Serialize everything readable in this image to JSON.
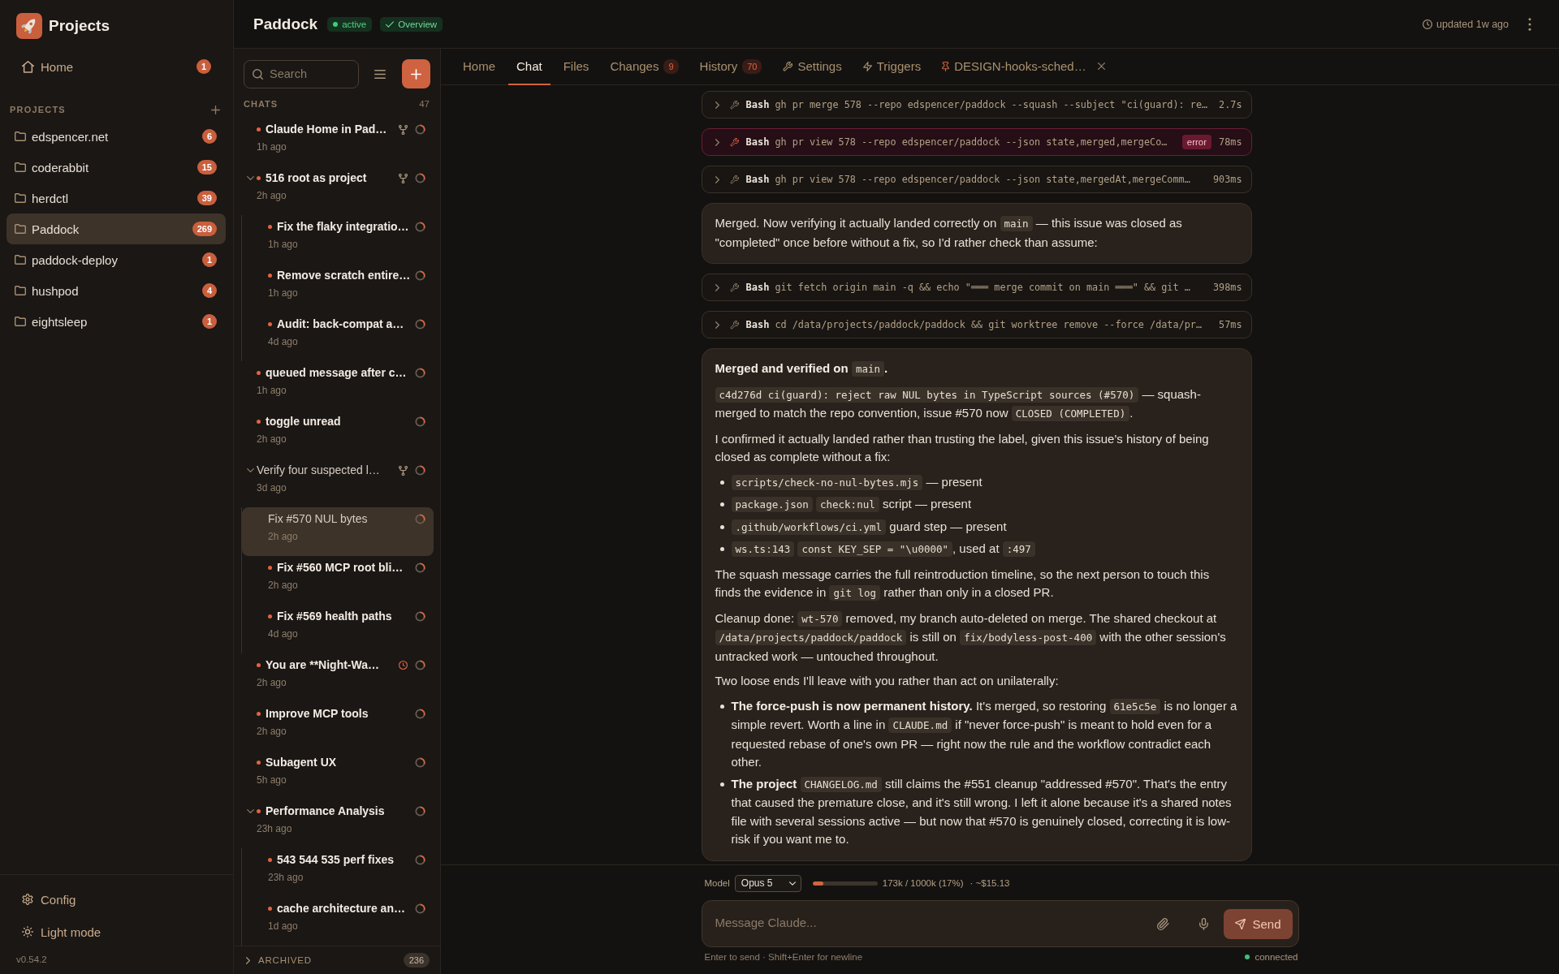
{
  "sidebar": {
    "title": "Projects",
    "home": {
      "label": "Home",
      "badge": "1"
    },
    "section_label": "PROJECTS",
    "projects": [
      {
        "name": "edspencer.net",
        "badge": "6",
        "selected": false
      },
      {
        "name": "coderabbit",
        "badge": "15",
        "selected": false
      },
      {
        "name": "herdctl",
        "badge": "39",
        "selected": false
      },
      {
        "name": "Paddock",
        "badge": "269",
        "selected": true
      },
      {
        "name": "paddock-deploy",
        "badge": "1",
        "selected": false
      },
      {
        "name": "hushpod",
        "badge": "4",
        "selected": false
      },
      {
        "name": "eightsleep",
        "badge": "1",
        "selected": false
      }
    ],
    "footer": [
      {
        "kind": "config",
        "label": "Config"
      },
      {
        "kind": "theme",
        "label": "Light mode"
      }
    ],
    "version": "v0.54.2"
  },
  "header": {
    "title": "Paddock",
    "status": "active",
    "overview": "Overview",
    "updated": "updated 1w ago"
  },
  "chat_list": {
    "search": {
      "placeholder": "Search"
    },
    "section_label": "CHATS",
    "count": "47",
    "chats": [
      {
        "title": "Claude Home in Pad…",
        "time": "1h ago",
        "kind": "branch",
        "unread": true,
        "selected": false
      },
      {
        "title": "516 root as project",
        "time": "2h ago",
        "kind": "branch",
        "unread": true,
        "selected": false,
        "expanded": true,
        "children": [
          {
            "title": "Fix the flaky integratio…",
            "time": "1h ago",
            "unread": true,
            "selected": false
          },
          {
            "title": "Remove scratch entire…",
            "time": "1h ago",
            "unread": true,
            "selected": false
          },
          {
            "title": "Audit: back-compat a…",
            "time": "4d ago",
            "unread": true,
            "selected": false
          }
        ]
      },
      {
        "title": "queued message after c…",
        "time": "1h ago",
        "unread": true,
        "selected": false
      },
      {
        "title": "toggle unread",
        "time": "2h ago",
        "unread": true,
        "selected": false
      },
      {
        "title": "Verify four suspected l…",
        "time": "3d ago",
        "kind": "branch",
        "unread": false,
        "selected": false,
        "expanded": true,
        "children": [
          {
            "title": "Fix #570 NUL bytes",
            "time": "2h ago",
            "unread": false,
            "selected": true
          },
          {
            "title": "Fix #560 MCP root bli…",
            "time": "2h ago",
            "unread": true,
            "selected": false
          },
          {
            "title": "Fix #569 health paths",
            "time": "4d ago",
            "unread": true,
            "selected": false
          }
        ]
      },
      {
        "title": "You are **Night-Wa…",
        "time": "2h ago",
        "kind": "scheduled",
        "unread": true,
        "selected": false
      },
      {
        "title": "Improve MCP tools",
        "time": "2h ago",
        "unread": true,
        "selected": false
      },
      {
        "title": "Subagent UX",
        "time": "5h ago",
        "unread": true,
        "selected": false
      },
      {
        "title": "Performance Analysis",
        "time": "23h ago",
        "unread": true,
        "selected": false,
        "expanded": true,
        "children": [
          {
            "title": "543 544 535 perf fixes",
            "time": "23h ago",
            "unread": true,
            "selected": false
          },
          {
            "title": "cache architecture an…",
            "time": "1d ago",
            "unread": true,
            "selected": false
          }
        ]
      }
    ],
    "archived": {
      "label": "ARCHIVED",
      "count": "236",
      "expanded": false
    }
  },
  "tabs": [
    {
      "label": "Home",
      "selected": false
    },
    {
      "label": "Chat",
      "selected": true
    },
    {
      "label": "Files",
      "selected": false
    },
    {
      "label": "Changes",
      "badge": "9",
      "selected": false
    },
    {
      "label": "History",
      "badge": "70",
      "selected": false
    },
    {
      "kind": "settings",
      "label": "Settings",
      "selected": false
    },
    {
      "kind": "triggers",
      "label": "Triggers",
      "selected": false
    },
    {
      "kind": "pinned",
      "label": "DESIGN-hooks-sched…",
      "selected": false
    }
  ],
  "messages": [
    {
      "kind": "tool",
      "tool": "Bash",
      "command": "gh pr merge 578 --repo edspencer/paddock --squash --subject \"ci(guard): re…",
      "duration": "2.7s",
      "error": false
    },
    {
      "kind": "tool",
      "tool": "Bash",
      "command": "gh pr view 578 --repo edspencer/paddock --json state,merged,mergeCo…",
      "duration": "78ms",
      "error": true,
      "error_badge": "error"
    },
    {
      "kind": "tool",
      "tool": "Bash",
      "command": "gh pr view 578 --repo edspencer/paddock --json state,mergedAt,mergeComm…",
      "duration": "903ms",
      "error": false
    },
    {
      "kind": "text",
      "blocks": [
        {
          "kind": "paragraph",
          "segments": [
            {
              "text": "Merged. Now verifying it actually landed correctly on "
            },
            {
              "code": "main"
            },
            {
              "text": " — this issue was closed as \"completed\" once before without a fix, so I'd rather check than assume:"
            }
          ]
        }
      ]
    },
    {
      "kind": "tool",
      "tool": "Bash",
      "command": "git fetch origin main -q && echo \"═══ merge commit on main ═══\" && git …",
      "duration": "398ms",
      "error": false
    },
    {
      "kind": "tool",
      "tool": "Bash",
      "command": "cd /data/projects/paddock/paddock && git worktree remove --force /data/pr…",
      "duration": "57ms",
      "error": false
    },
    {
      "kind": "text",
      "blocks": [
        {
          "kind": "paragraph",
          "segments": [
            {
              "text": "**Merged and verified on** "
            },
            {
              "code": "main"
            },
            {
              "text": "**.**"
            }
          ]
        },
        {
          "kind": "paragraph",
          "segments": [
            {
              "code": "c4d276d ci(guard): reject raw NUL bytes in TypeScript sources (#570)"
            },
            {
              "text": " — squash-merged to match the repo convention, issue #570 now "
            },
            {
              "code": "CLOSED (COMPLETED)"
            },
            {
              "text": "."
            }
          ]
        },
        {
          "kind": "paragraph",
          "segments": [
            {
              "text": "I confirmed it actually landed rather than trusting the label, given this issue's history of being closed as complete without a fix:"
            }
          ]
        },
        {
          "kind": "list",
          "items": [
            [
              {
                "code": "scripts/check-no-nul-bytes.mjs"
              },
              {
                "text": " — present"
              }
            ],
            [
              {
                "code": "package.json"
              },
              {
                "code": "check:nul"
              },
              {
                "text": " script — present"
              }
            ],
            [
              {
                "code": ".github/workflows/ci.yml"
              },
              {
                "text": " guard step — present"
              }
            ],
            [
              {
                "code": "ws.ts:143"
              },
              {
                "code": "const KEY_SEP = \"\\u0000\""
              },
              {
                "text": ", used at "
              },
              {
                "code": ":497"
              }
            ]
          ]
        },
        {
          "kind": "paragraph",
          "segments": [
            {
              "text": "The squash message carries the full reintroduction timeline, so the next person to touch this finds the evidence in "
            },
            {
              "code": "git log"
            },
            {
              "text": " rather than only in a closed PR."
            }
          ]
        },
        {
          "kind": "paragraph",
          "segments": [
            {
              "text": "Cleanup done: "
            },
            {
              "code": "wt-570"
            },
            {
              "text": " removed, my branch auto-deleted on merge. The shared checkout at "
            },
            {
              "code": "/data/projects/paddock/paddock"
            },
            {
              "text": " is still on "
            },
            {
              "code": "fix/bodyless-post-400"
            },
            {
              "text": " with the other session's untracked work — untouched throughout."
            }
          ]
        },
        {
          "kind": "paragraph",
          "segments": [
            {
              "text": "Two loose ends I'll leave with you rather than act on unilaterally:"
            }
          ]
        },
        {
          "kind": "list",
          "items": [
            [
              {
                "text": "**The force-push is now permanent history.** It's merged, so restoring "
              },
              {
                "code": "61e5c5e"
              },
              {
                "text": " is no longer a simple revert. Worth a line in "
              },
              {
                "code": "CLAUDE.md"
              },
              {
                "text": " if \"never force-push\" is meant to hold even for a requested rebase of one's own PR — right now the rule and the workflow contradict each other."
              }
            ],
            [
              {
                "text": "**The project** "
              },
              {
                "code": "CHANGELOG.md"
              },
              {
                "text": " still claims the #551 cleanup \"addressed #570\". That's the entry that caused the premature close, and it's still wrong. I left it alone because it's a shared notes file with several sessions active — but now that #570 is genuinely closed, correcting it is low-risk if you want me to."
              }
            ]
          ]
        }
      ]
    }
  ],
  "composer": {
    "model_label": "Model",
    "model": "Opus 5",
    "context": {
      "level": 0.17,
      "reading": "173k / 1000k (17%)"
    },
    "cost": "· ~$15.13",
    "input": {
      "placeholder": "Message Claude..."
    },
    "send": "Send",
    "hint": "Enter to send · Shift+Enter for newline",
    "connection": {
      "label": "connected",
      "connected": true
    }
  }
}
